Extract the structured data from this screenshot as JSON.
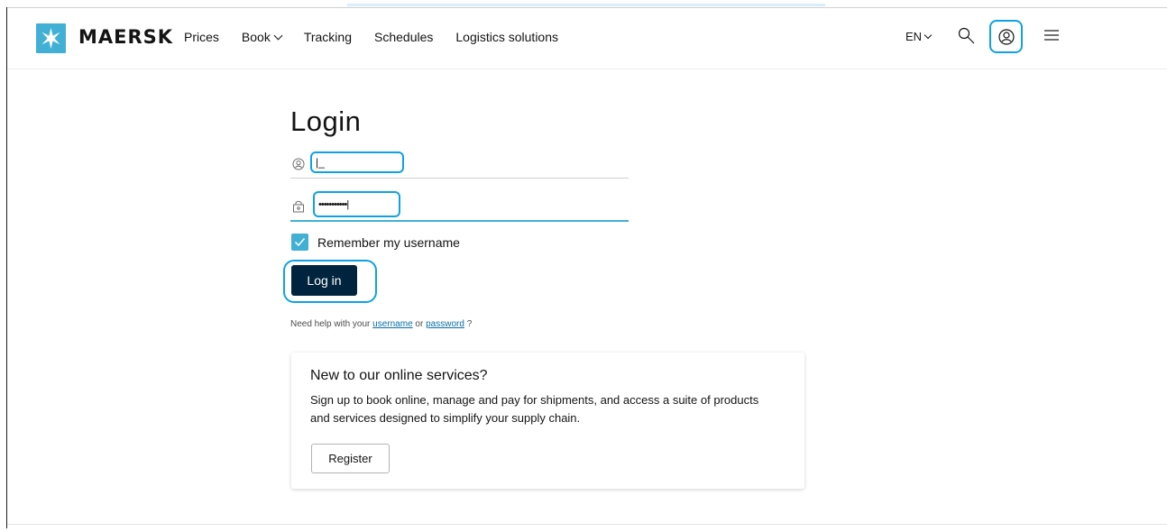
{
  "header": {
    "brand": "MAERSK",
    "nav": [
      {
        "label": "Prices",
        "has_dropdown": false
      },
      {
        "label": "Book",
        "has_dropdown": true
      },
      {
        "label": "Tracking",
        "has_dropdown": false
      },
      {
        "label": "Schedules",
        "has_dropdown": false
      },
      {
        "label": "Logistics solutions",
        "has_dropdown": false
      }
    ],
    "language": "EN",
    "icons": [
      "search-icon",
      "user-icon",
      "menu-icon"
    ]
  },
  "login": {
    "title": "Login",
    "username": {
      "value": "|_"
    },
    "password": {
      "value": "•••••••••••|"
    },
    "remember_label": "Remember my username",
    "remember_checked": true,
    "submit_label": "Log in",
    "help": {
      "prefix": "Need help with your",
      "username_link": "username",
      "connector": "or",
      "password_link": "password",
      "suffix": "?"
    }
  },
  "signup_card": {
    "title": "New to our online services?",
    "body": "Sign up to book online, manage and pay for shipments, and access a suite of products and services designed to simplify your supply chain.",
    "register_label": "Register"
  },
  "colors": {
    "brand_blue": "#42b0d5",
    "primary_button": "#00243d",
    "highlight_ring": "#0ea2e5",
    "link": "#0c6ea6"
  }
}
